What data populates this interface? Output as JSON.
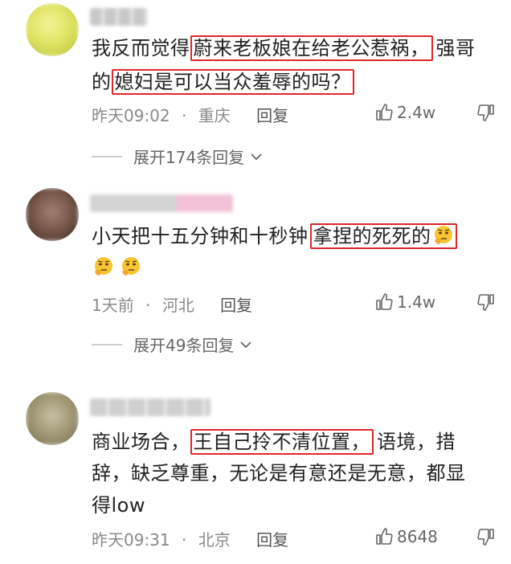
{
  "comments": [
    {
      "lines": [
        {
          "pre": "我反而觉得",
          "hl": "蔚来老板娘在给老公惹祸，",
          "post": "强哥"
        },
        {
          "pre": "的",
          "hl": "媳妇是可以当众羞辱的吗？",
          "post": ""
        }
      ],
      "time": "昨天09:02",
      "location": "重庆",
      "reply_label": "回复",
      "likes": "2.4w",
      "expand_label": "展开174条回复"
    },
    {
      "lines": [
        {
          "pre": "小天把十五分钟和十秒钟",
          "hl": "拿捏的死死的",
          "post": ""
        }
      ],
      "time": "1天前",
      "location": "河北",
      "reply_label": "回复",
      "likes": "1.4w",
      "expand_label": "展开49条回复"
    },
    {
      "lines": [
        {
          "pre": "商业场合，",
          "hl": "王自己拎不清位置，",
          "post": "语境，措"
        },
        {
          "pre": "辞，缺乏尊重，无论是有意还是无意，都显",
          "hl": "",
          "post": ""
        },
        {
          "pre": "得low",
          "hl": "",
          "post": ""
        }
      ],
      "time": "昨天09:31",
      "location": "北京",
      "reply_label": "回复",
      "likes": "8648"
    }
  ],
  "separator": "·",
  "icons": {
    "like": "thumbs-up-icon",
    "dislike": "thumbs-down-icon",
    "expand": "chevron-down-icon",
    "emoji": "thinking-face-emoji"
  },
  "colors": {
    "highlight_border": "#e0262b",
    "meta_text": "#8a8a8a"
  }
}
